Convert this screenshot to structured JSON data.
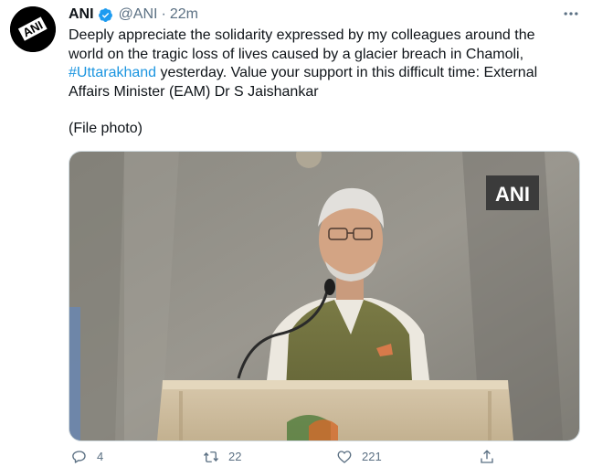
{
  "tweet": {
    "author_name": "ANI",
    "handle": "@ANI",
    "separator": "·",
    "time": "22m",
    "avatar_text": "ANI",
    "text_lines": [
      "Deeply appreciate the solidarity expressed by my colleagues around the",
      "world on the tragic loss of lives caused by a glacier breach in Chamoli,"
    ],
    "hashtag": "#Uttarakhand",
    "text_after_hashtag": " yesterday. Value your support in this difficult time: External",
    "text_last_line": "Affairs Minister (EAM) Dr S Jaishankar",
    "file_photo": "(File photo)",
    "media": {
      "watermark": "ANI",
      "alt_icon_names": [
        "speaker-at-podium-photo"
      ]
    },
    "actions": {
      "reply_count": "4",
      "retweet_count": "22",
      "like_count": "221"
    }
  },
  "icons": {
    "more": "more-horizontal-icon",
    "verified": "verified-badge-icon",
    "reply": "reply-icon",
    "retweet": "retweet-icon",
    "like": "heart-icon",
    "share": "share-icon"
  },
  "colors": {
    "verified_blue": "#1d9bf0",
    "hashtag_blue": "#1b95e0",
    "muted_gray": "#5b7083",
    "text": "#0f1419"
  }
}
